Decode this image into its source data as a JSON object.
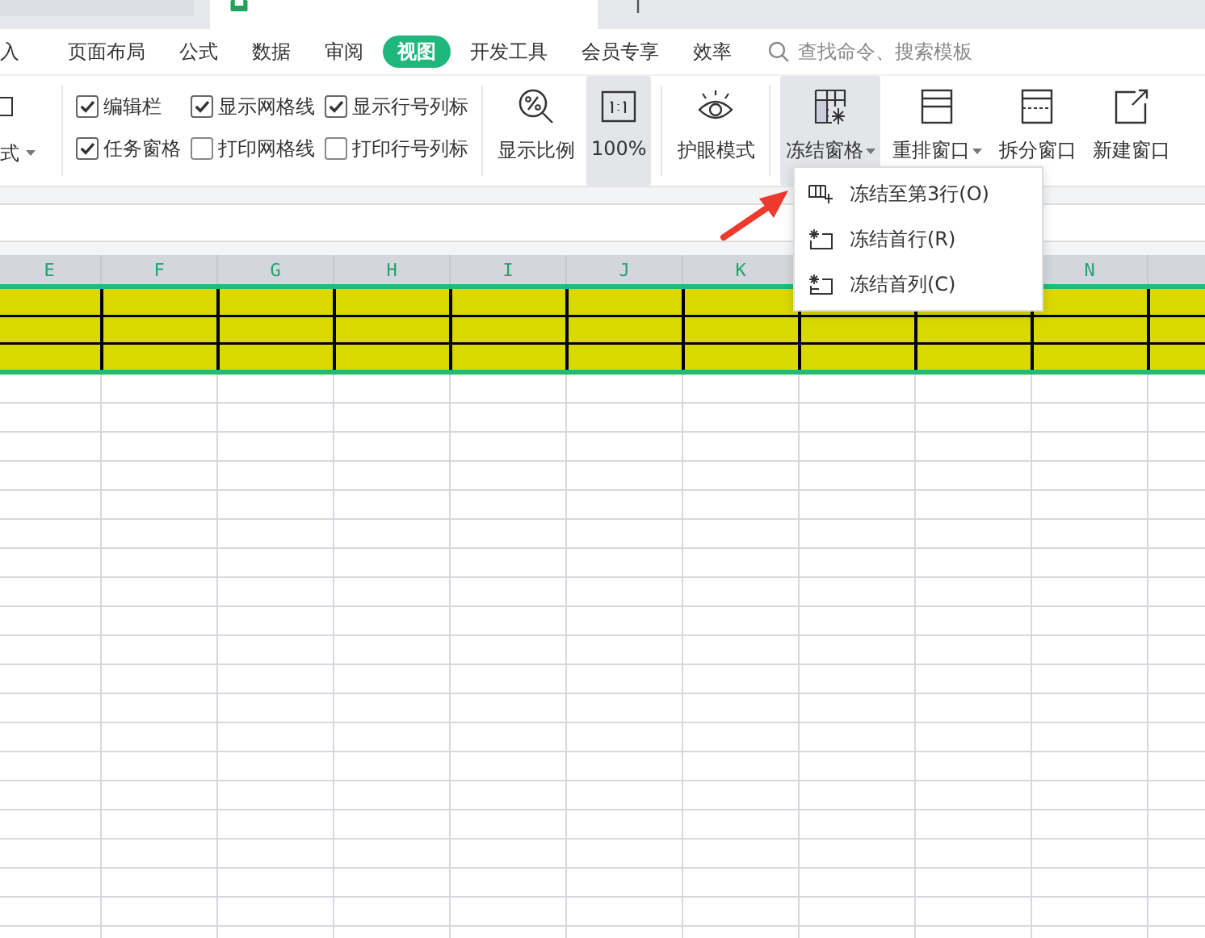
{
  "menu_tabs": [
    {
      "label": "入",
      "selected": false
    },
    {
      "label": "页面布局",
      "selected": false
    },
    {
      "label": "公式",
      "selected": false
    },
    {
      "label": "数据",
      "selected": false
    },
    {
      "label": "审阅",
      "selected": false
    },
    {
      "label": "视图",
      "selected": true
    },
    {
      "label": "开发工具",
      "selected": false
    },
    {
      "label": "会员专享",
      "selected": false
    },
    {
      "label": "效率",
      "selected": false
    }
  ],
  "search": {
    "placeholder": "查找命令、搜索模板"
  },
  "ribbon_left": {
    "label": "式",
    "checked": false
  },
  "checkboxes": [
    {
      "label": "编辑栏",
      "checked": true
    },
    {
      "label": "任务窗格",
      "checked": true
    },
    {
      "label": "显示网格线",
      "checked": true
    },
    {
      "label": "打印网格线",
      "checked": false
    },
    {
      "label": "显示行号列标",
      "checked": true
    },
    {
      "label": "打印行号列标",
      "checked": false
    }
  ],
  "ribbon_buttons": [
    {
      "kind": "zoom",
      "label": "显示比例",
      "selected": false,
      "dropdown": false
    },
    {
      "kind": "actual",
      "label": "100%",
      "selected": true,
      "dropdown": false
    },
    {
      "kind": "eye",
      "label": "护眼模式",
      "selected": false,
      "dropdown": false
    },
    {
      "kind": "freeze",
      "label": "冻结窗格",
      "selected": true,
      "dropdown": true
    },
    {
      "kind": "arrange",
      "label": "重排窗口",
      "selected": false,
      "dropdown": true
    },
    {
      "kind": "split",
      "label": "拆分窗口",
      "selected": false,
      "dropdown": false
    },
    {
      "kind": "new",
      "label": "新建窗口",
      "selected": false,
      "dropdown": false
    }
  ],
  "sheet": {
    "column_headers": [
      "E",
      "F",
      "G",
      "H",
      "I",
      "J",
      "K"
    ],
    "column_headers_right": [
      "N"
    ]
  },
  "freeze_menu": [
    {
      "kind": "rows",
      "label": "冻结至第3行(O)"
    },
    {
      "kind": "first_row",
      "label": "冻结首行(R)"
    },
    {
      "kind": "first_col",
      "label": "冻结首列(C)"
    }
  ]
}
